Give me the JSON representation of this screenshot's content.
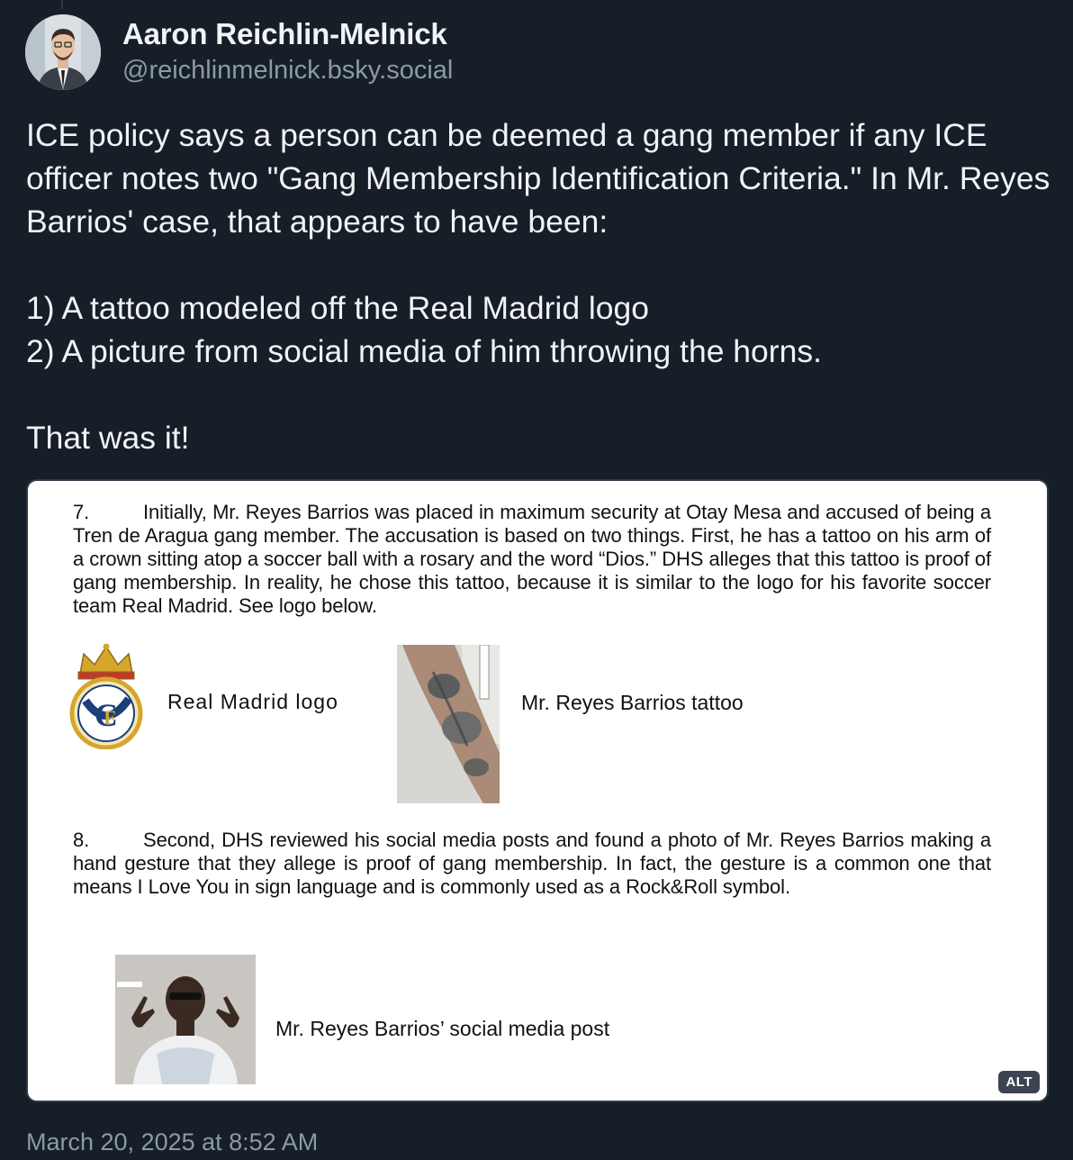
{
  "author": {
    "display_name": "Aaron Reichlin-Melnick",
    "handle": "@reichlinmelnick.bsky.social"
  },
  "post": {
    "paragraph_1": "ICE policy says a person can be deemed a gang member if any ICE officer notes two \"Gang Membership Identification Criteria.\" In Mr. Reyes Barrios' case, that appears to have been:",
    "list_item_1": "1) A tattoo modeled off the Real Madrid logo",
    "list_item_2": "2) A picture from social media of him throwing the horns.",
    "closing": "That was it!"
  },
  "embed": {
    "para_7_number": "7.",
    "para_7_text": "Initially, Mr. Reyes Barrios was placed in maximum security at Otay Mesa and accused of being a Tren de Aragua gang member. The accusation is based on two things. First, he has a tattoo on his arm of a crown sitting atop a soccer ball with a rosary and the word “Dios.” DHS alleges that this tattoo is proof of gang membership. In reality, he chose this tattoo, because it is similar to the logo for his favorite soccer team Real Madrid. See logo below.",
    "logo_caption": "Real  Madrid  logo",
    "tattoo_caption": "Mr. Reyes Barrios tattoo",
    "para_8_number": "8.",
    "para_8_text": "Second, DHS reviewed his social media posts and found a photo of Mr. Reyes Barrios making a hand gesture that they allege is proof of gang membership. In fact, the gesture is a common one that means I Love You in sign language and is commonly used as a Rock&Roll symbol.",
    "social_caption": "Mr. Reyes Barrios’ social media post",
    "alt_badge": "ALT"
  },
  "timestamp": "March 20, 2025 at 8:52 AM",
  "colors": {
    "background": "#161e27",
    "text_primary": "#f1f3f5",
    "text_secondary": "#8c99a8",
    "logo_gold": "#d4a72c",
    "logo_blue": "#1c3f7a"
  }
}
